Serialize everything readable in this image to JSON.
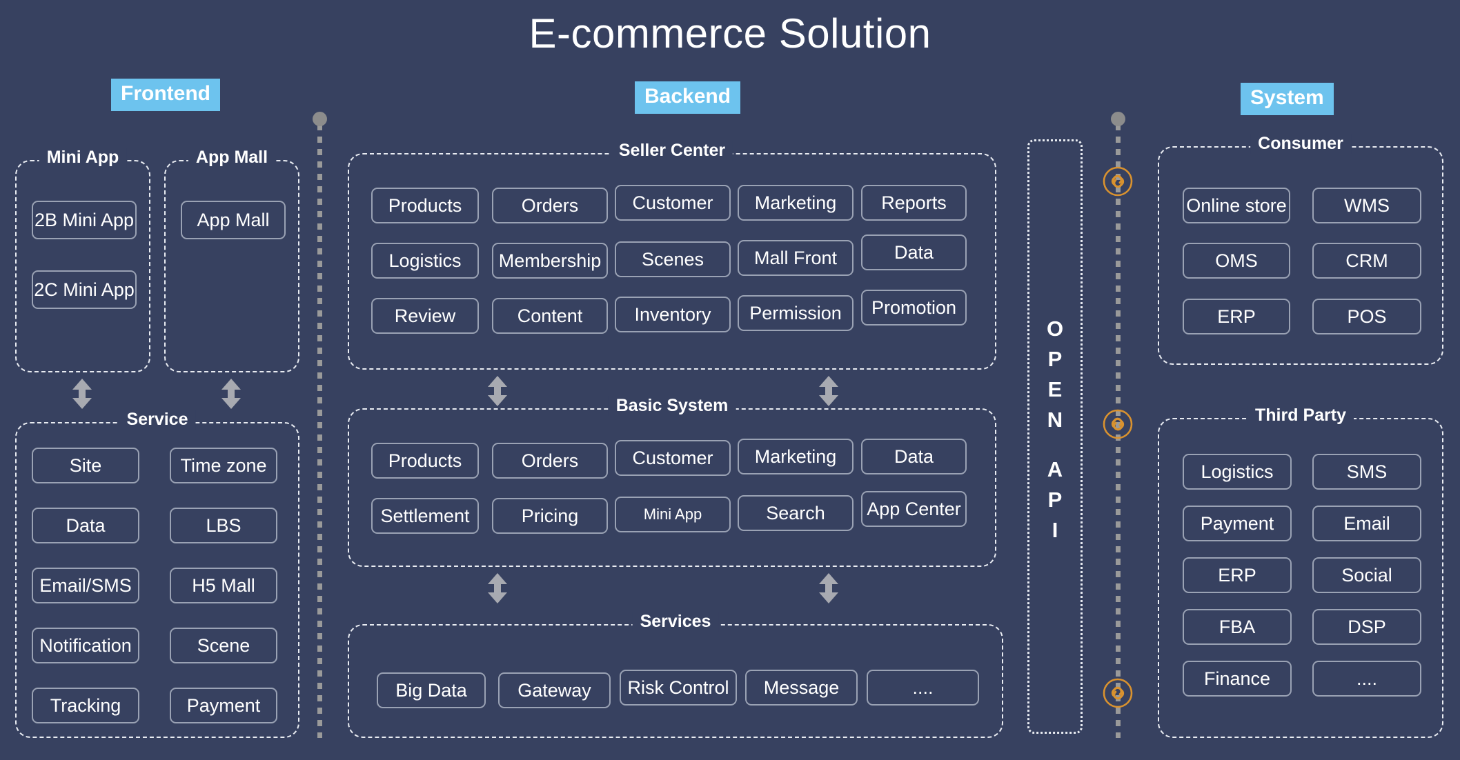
{
  "title": "E-commerce Solution",
  "colors": {
    "background": "#374160",
    "accent": "#6dc3ee",
    "box_border": "#9aa2b4",
    "panel_border": "#e9ecf2",
    "divider": "#9a9a9a",
    "chain": "#d9922f",
    "arrow": "#a8aab1",
    "text": "#ffffff"
  },
  "column_labels": {
    "frontend": "Frontend",
    "backend": "Backend",
    "system": "System"
  },
  "frontend": {
    "groups": [
      {
        "title": "Mini App",
        "items": [
          "2B Mini App",
          "2C Mini App"
        ]
      },
      {
        "title": "App Mall",
        "items": [
          "App Mall"
        ]
      }
    ],
    "service": {
      "title": "Service",
      "left_items": [
        "Site",
        "Data",
        "Email/SMS",
        "Notification",
        "Tracking"
      ],
      "right_items": [
        "Time zone",
        "LBS",
        "H5 Mall",
        "Scene",
        "Payment"
      ]
    }
  },
  "backend": {
    "seller_center": {
      "title": "Seller Center",
      "rows": [
        [
          "Products",
          "Orders",
          "Customer",
          "Marketing",
          "Reports"
        ],
        [
          "Logistics",
          "Membership",
          "Scenes",
          "Mall Front",
          "Data"
        ],
        [
          "Review",
          "Content",
          "Inventory",
          "Permission",
          "Promotion"
        ]
      ]
    },
    "basic_system": {
      "title": "Basic System",
      "rows": [
        [
          "Products",
          "Orders",
          "Customer",
          "Marketing",
          "Data"
        ],
        [
          "Settlement",
          "Pricing",
          "Mini App",
          "Search",
          "App Center"
        ]
      ]
    },
    "services": {
      "title": "Services",
      "items": [
        "Big Data",
        "Gateway",
        "Risk Control",
        "Message",
        "...."
      ]
    }
  },
  "open_api": {
    "label": "OPEN API",
    "letters_top": [
      "O",
      "P",
      "E",
      "N"
    ],
    "letters_bottom": [
      "A",
      "P",
      "I"
    ]
  },
  "system": {
    "consumer": {
      "title": "Consumer",
      "left_items": [
        "Online store",
        "OMS",
        "ERP"
      ],
      "right_items": [
        "WMS",
        "CRM",
        "POS"
      ]
    },
    "third_party": {
      "title": "Third Party",
      "left_items": [
        "Logistics",
        "Payment",
        "ERP",
        "FBA",
        "Finance"
      ],
      "right_items": [
        "SMS",
        "Email",
        "Social",
        "DSP",
        "...."
      ]
    }
  },
  "connectors": {
    "chain_icon": "link-chain-icon",
    "chain_count": 3,
    "arrow_icon": "double-headed-vertical-arrow-icon"
  }
}
